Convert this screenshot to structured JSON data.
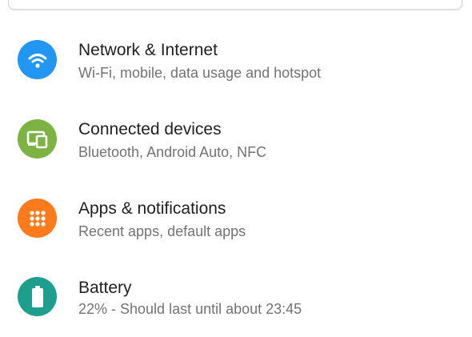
{
  "colors": {
    "network": "#2196F3",
    "connected_devices": "#7CB342",
    "apps": "#FF7A1A",
    "battery": "#1E9E8C"
  },
  "settings": {
    "items": [
      {
        "title": "Network & Internet",
        "summary": "Wi-Fi, mobile, data usage and hotspot",
        "icon": "wifi-icon"
      },
      {
        "title": "Connected devices",
        "summary": "Bluetooth, Android Auto, NFC",
        "icon": "devices-icon"
      },
      {
        "title": "Apps & notifications",
        "summary": "Recent apps, default apps",
        "icon": "apps-grid-icon"
      },
      {
        "title": "Battery",
        "summary": "22% - Should last until about 23:45",
        "icon": "battery-icon"
      }
    ]
  }
}
